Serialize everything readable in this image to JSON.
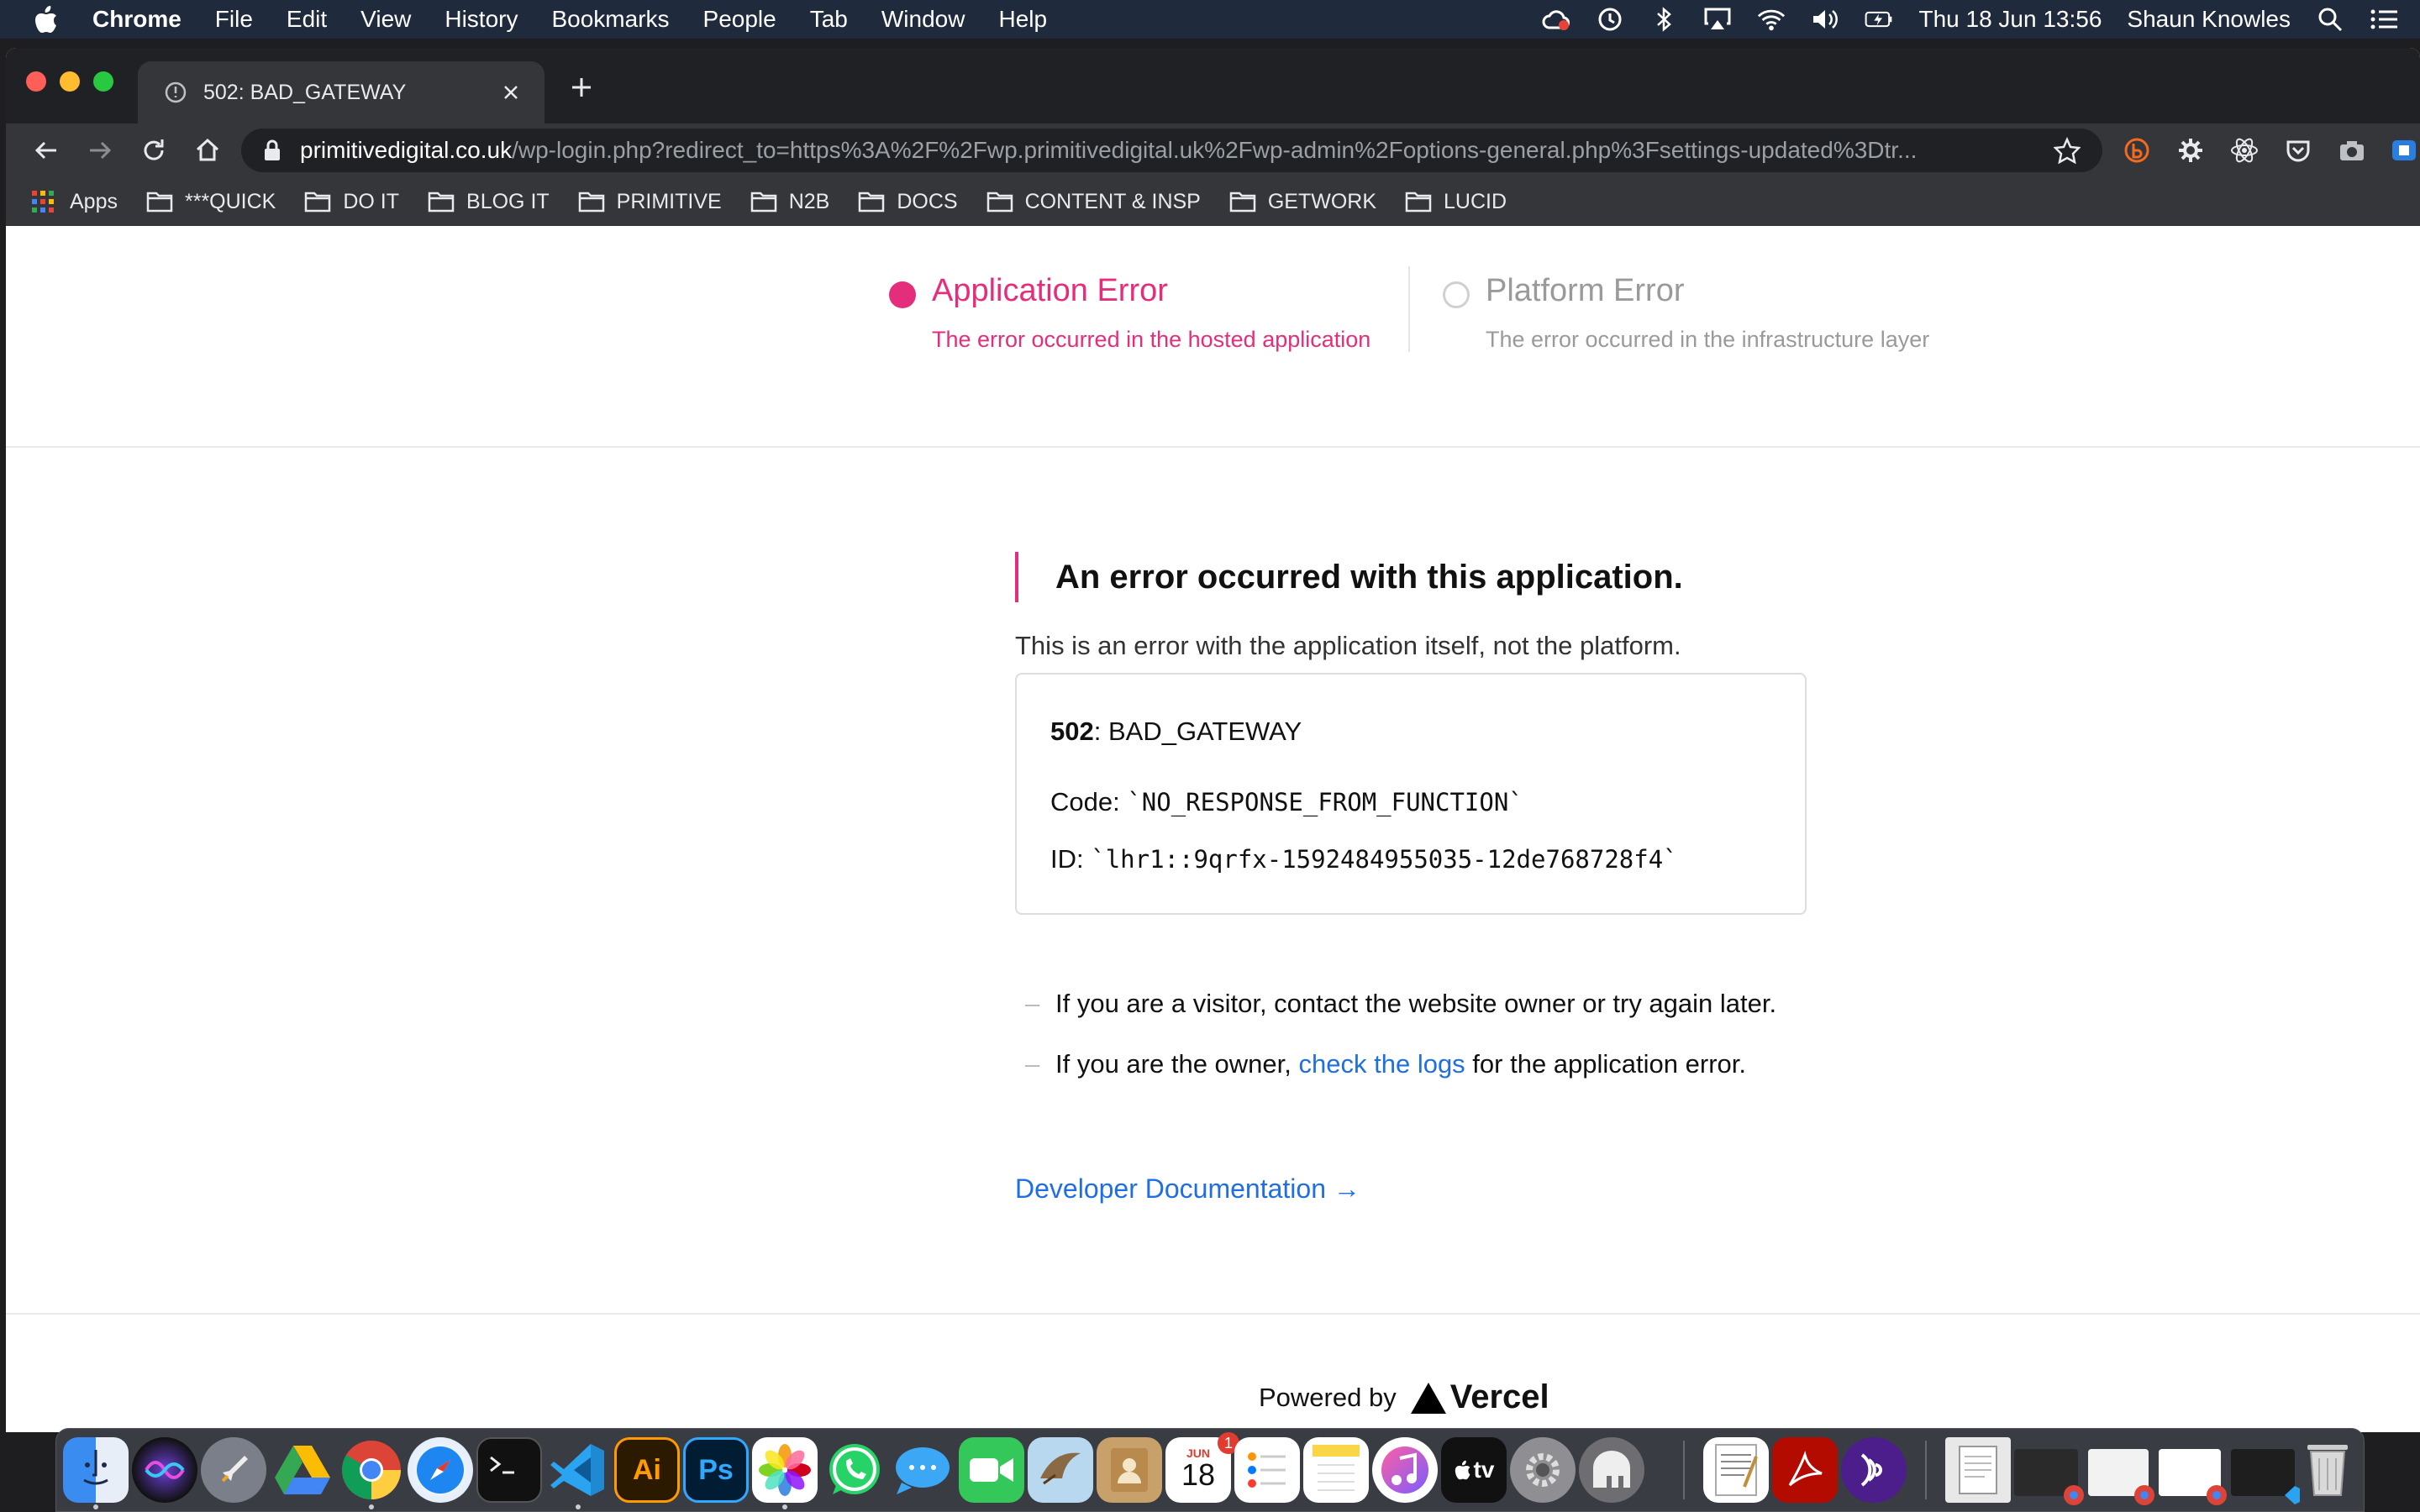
{
  "menubar": {
    "app_name": "Chrome",
    "items": [
      "File",
      "Edit",
      "View",
      "History",
      "Bookmarks",
      "People",
      "Tab",
      "Window",
      "Help"
    ],
    "clock": "Thu 18 Jun  13:56",
    "user": "Shaun Knowles"
  },
  "browser": {
    "tab_title": "502: BAD_GATEWAY",
    "url_host": "primitivedigital.co.uk",
    "url_path": "/wp-login.php?redirect_to=https%3A%2F%2Fwp.primitivedigital.uk%2Fwp-admin%2Foptions-general.php%3Fsettings-updated%3Dtr...",
    "bookmarks": [
      "Apps",
      "***QUICK",
      "DO IT",
      "BLOG IT",
      "PRIMITIVE",
      "N2B",
      "DOCS",
      "CONTENT & INSP",
      "GETWORK",
      "LUCID"
    ]
  },
  "error_types": {
    "application": {
      "title": "Application Error",
      "subtitle": "The error occurred in the hosted application"
    },
    "platform": {
      "title": "Platform Error",
      "subtitle": "The error occurred in the infrastructure layer"
    }
  },
  "main": {
    "headline": "An error occurred with this application.",
    "lead": "This is an error with the application itself, not the platform.",
    "status_code": "502",
    "status_text": ": BAD_GATEWAY",
    "code_label": "Code: ",
    "code_value": "`NO_RESPONSE_FROM_FUNCTION`",
    "id_label": "ID: ",
    "id_value": "`lhr1::9qrfx-1592484955035-12de768728f4`",
    "bullet1": "If you are a visitor, contact the website owner or try again later.",
    "bullet2_pre": "If you are the owner, ",
    "bullet2_link": "check the logs",
    "bullet2_post": " for the application error.",
    "dash": "–",
    "dev_link": "Developer Documentation →"
  },
  "footer": {
    "powered_by": "Powered by",
    "brand": "Vercel"
  },
  "dock": {
    "illustrator_label": "Ai",
    "photoshop_label": "Ps",
    "calendar_month": "JUN",
    "calendar_day": "18",
    "calendar_badge": "1",
    "tv_label": "tv"
  },
  "colors": {
    "accent": "#e42e7c",
    "link": "#1f6fe3",
    "menubar": "#1f2a3d"
  }
}
